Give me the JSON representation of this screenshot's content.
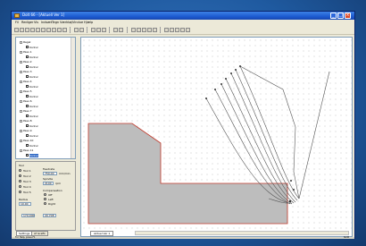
{
  "window": {
    "title": "Dolt 66 - [Aktuell Ver 1]"
  },
  "menu": [
    {
      "label": "Fil"
    },
    {
      "label": "Rediger"
    },
    {
      "label": "Vis"
    },
    {
      "label": "Indsæt"
    },
    {
      "label": "Tegn"
    },
    {
      "label": "Værktøj"
    },
    {
      "label": "Vindue"
    },
    {
      "label": "Hjælp"
    }
  ],
  "tree": {
    "items": [
      {
        "kind": "parent",
        "label": "Regel"
      },
      {
        "kind": "child",
        "label": "Kontur"
      },
      {
        "kind": "parent",
        "label": "Pass 1"
      },
      {
        "kind": "child",
        "label": "Kontur"
      },
      {
        "kind": "parent",
        "label": "Pass 2"
      },
      {
        "kind": "child",
        "label": "Kontur"
      },
      {
        "kind": "parent",
        "label": "Pass 3"
      },
      {
        "kind": "child",
        "label": "Kontur"
      },
      {
        "kind": "parent",
        "label": "Pass 4"
      },
      {
        "kind": "child",
        "label": "Kontur"
      },
      {
        "kind": "parent",
        "label": "Pass 5"
      },
      {
        "kind": "child",
        "label": "Kontur"
      },
      {
        "kind": "parent",
        "label": "Pass 6"
      },
      {
        "kind": "child",
        "label": "Kontur"
      },
      {
        "kind": "parent",
        "label": "Pass 7"
      },
      {
        "kind": "child",
        "label": "Kontur"
      },
      {
        "kind": "parent",
        "label": "Pass 8"
      },
      {
        "kind": "child",
        "label": "Kontur"
      },
      {
        "kind": "parent",
        "label": "Pass 9"
      },
      {
        "kind": "child",
        "label": "Kontur"
      },
      {
        "kind": "parent",
        "label": "Pass 10"
      },
      {
        "kind": "child",
        "label": "Kontur"
      },
      {
        "kind": "parent",
        "label": "Pass 11"
      },
      {
        "kind": "child",
        "label": "Kontur",
        "selected": true
      }
    ]
  },
  "props": {
    "tool_group": "Tool",
    "tools": [
      "Tool 1",
      "Tool 2",
      "Tool 3",
      "Tool 4",
      "Tool 5"
    ],
    "feedrate_label": "Feedrate",
    "feedrate_value": "750.00",
    "feedrate_unit": "mm/min",
    "spindle_label": "Spindle",
    "spindle_value": "2100",
    "spindle_unit": "rpm",
    "comp_label": "Compensation",
    "comp_options": [
      "Off",
      "Left",
      "Right"
    ],
    "radius_label": "Radius",
    "radius_value": "10.00",
    "x_value": "170.000",
    "y_value": "20.708"
  },
  "left_tabs": [
    "Settings",
    "Af Grafik"
  ],
  "canvas": {
    "tab_label": "Aktuel Ver 1"
  },
  "status": {
    "text": "For Help, press F1",
    "right": "NUM"
  },
  "colors": {
    "titlebar": "#1c5ad1",
    "part_fill": "#bdbdbd",
    "part_edge": "#c0392b",
    "toolpath": "#555555"
  }
}
